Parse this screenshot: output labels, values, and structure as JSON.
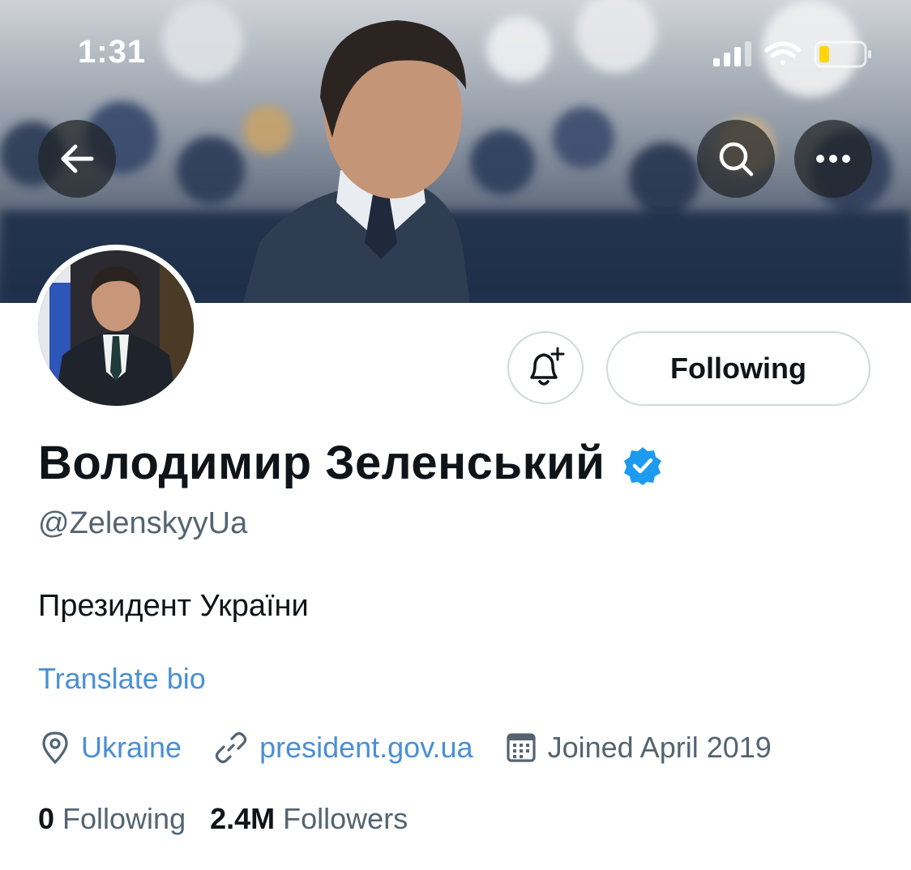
{
  "status_bar": {
    "time": "1:31"
  },
  "profile": {
    "display_name": "Володимир Зеленський",
    "handle": "@ZelenskyyUa",
    "bio": "Президент України",
    "translate_label": "Translate bio",
    "location": "Ukraine",
    "website": "president.gov.ua",
    "joined": "Joined April 2019",
    "following_count": "0",
    "following_label": "Following",
    "followers_count": "2.4M",
    "followers_label": "Followers"
  },
  "actions": {
    "follow_state_label": "Following",
    "notify_icon": "bell-plus-icon",
    "back_icon": "back-arrow-icon",
    "search_icon": "search-icon",
    "more_icon": "more-icon"
  },
  "colors": {
    "link": "#4a8fd4",
    "verified": "#1d9bf0",
    "muted": "#536471",
    "border": "#cfd9de"
  }
}
